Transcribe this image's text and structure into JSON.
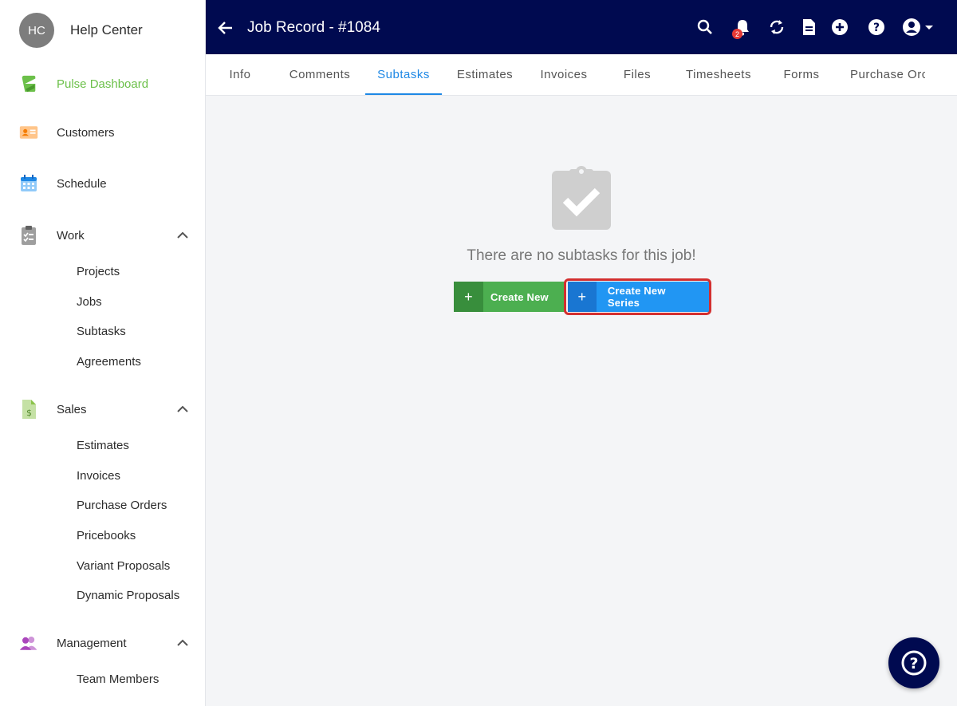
{
  "profile": {
    "initials": "HC",
    "name": "Help Center"
  },
  "sidebar": {
    "pulse": "Pulse Dashboard",
    "customers": "Customers",
    "schedule": "Schedule",
    "work": {
      "label": "Work",
      "items": [
        "Projects",
        "Jobs",
        "Subtasks",
        "Agreements"
      ]
    },
    "sales": {
      "label": "Sales",
      "items": [
        "Estimates",
        "Invoices",
        "Purchase Orders",
        "Pricebooks",
        "Variant Proposals",
        "Dynamic Proposals"
      ]
    },
    "management": {
      "label": "Management",
      "items": [
        "Team Members"
      ]
    }
  },
  "header": {
    "title": "Job Record - #1084",
    "notification_count": "2"
  },
  "tabs": [
    "Info",
    "Comments",
    "Subtasks",
    "Estimates",
    "Invoices",
    "Files",
    "Timesheets",
    "Forms",
    "Purchase Orc"
  ],
  "active_tab": "Subtasks",
  "empty_state": {
    "message": "There are no subtasks for this job!"
  },
  "buttons": {
    "create_new": "Create New",
    "create_new_series": "Create New Series",
    "plus": "+"
  },
  "colors": {
    "header": "#000a50",
    "accent": "#1e88e5",
    "green": "#4caf50",
    "blue": "#2196f3",
    "highlight": "#d32f2f",
    "active_nav": "#6cc04a"
  }
}
